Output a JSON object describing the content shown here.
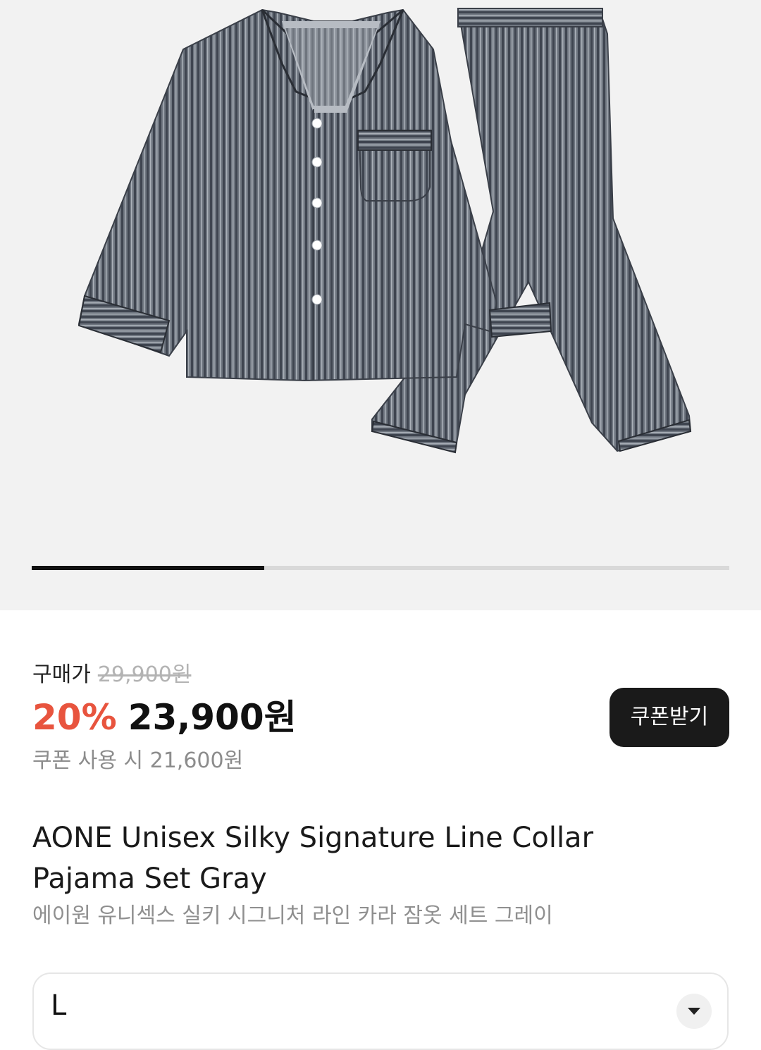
{
  "product": {
    "image_alt": "gray striped collar pajama set",
    "gallery": {
      "current_slide": 1,
      "progress": 0.333
    },
    "price_label": "구매가",
    "original_price": "29,900원",
    "discount_rate": "20%",
    "sale_price": "23,900원",
    "coupon_price_text": "쿠폰 사용 시 21,600원",
    "coupon_button_label": "쿠폰받기",
    "title_en": "AONE Unisex Silky Signature Line Collar Pajama Set Gray",
    "title_ko": "에이원 유니섹스 실키 시그니처 라인 카라 잠옷 세트 그레이",
    "option": {
      "selected_value": "L",
      "toggle_icon": "chevron-down-icon"
    }
  },
  "colors": {
    "discount": "#e8543e",
    "text_primary": "#111111",
    "button_bg": "#1a1a1a",
    "gallery_bg": "#f2f2f2"
  }
}
